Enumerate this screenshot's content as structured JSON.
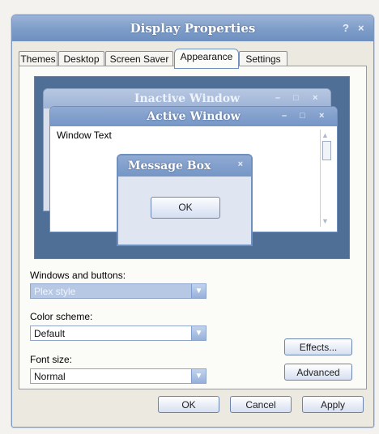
{
  "dialog": {
    "title": "Display Properties",
    "help_glyph": "?",
    "close_glyph": "×"
  },
  "tabs": [
    {
      "label": "Themes",
      "active": false
    },
    {
      "label": "Desktop",
      "active": false
    },
    {
      "label": "Screen Saver",
      "active": false
    },
    {
      "label": "Appearance",
      "active": true
    },
    {
      "label": "Settings",
      "active": false
    }
  ],
  "preview": {
    "inactive_title": "Inactive Window",
    "active_title": "Active Window",
    "window_text": "Window Text",
    "message_box_title": "Message Box",
    "message_ok": "OK",
    "minimize_glyph": "–",
    "maximize_glyph": "□",
    "close_glyph": "×"
  },
  "fields": {
    "windows_buttons": {
      "label": "Windows and buttons:",
      "value": "Plex style"
    },
    "color_scheme": {
      "label": "Color scheme:",
      "value": "Default"
    },
    "font_size": {
      "label": "Font size:",
      "value": "Normal"
    }
  },
  "side_buttons": {
    "effects": "Effects...",
    "advanced": "Advanced"
  },
  "footer": {
    "ok": "OK",
    "cancel": "Cancel",
    "apply": "Apply"
  },
  "colors": {
    "titlebar": "#7d9cc8",
    "preview_bg": "#4f6f96",
    "accent": "#6f8fbe"
  }
}
